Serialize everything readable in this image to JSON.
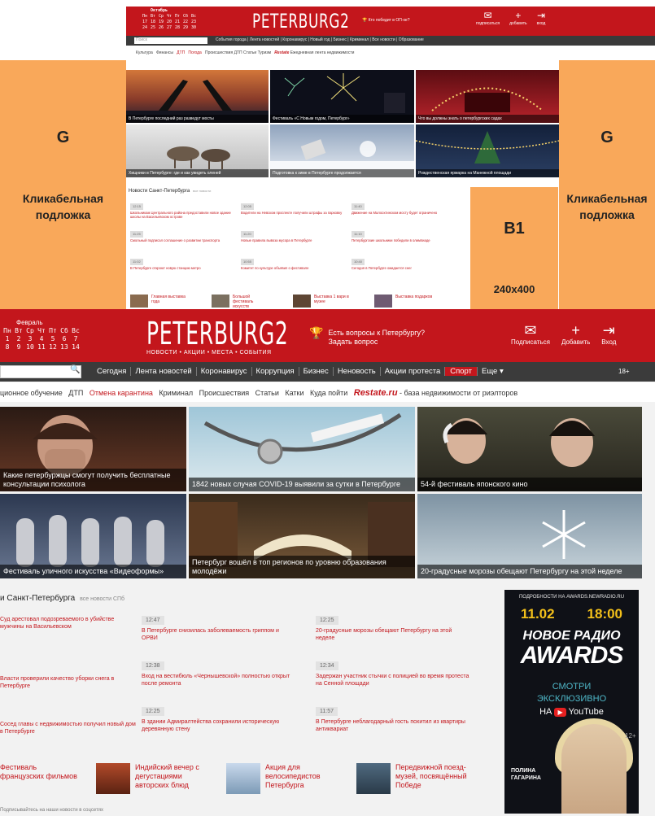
{
  "mock": {
    "calendar": {
      "month": "Октябрь",
      "weekdays": [
        "Пн",
        "Вт",
        "Ср",
        "Чт",
        "Пт",
        "Сб",
        "Вс"
      ],
      "rows": [
        [
          "17",
          "18",
          "19",
          "20",
          "21",
          "22",
          "23"
        ],
        [
          "24",
          "25",
          "26",
          "27",
          "28",
          "29",
          "30"
        ]
      ]
    },
    "logo": "PETERBURG2",
    "cup_text": "Кто победит в ОП-хе?",
    "actions": [
      {
        "icon": "✉",
        "label": "подписаться"
      },
      {
        "icon": "+",
        "label": "добавить"
      },
      {
        "icon": "⇥",
        "label": "вход"
      }
    ],
    "search_placeholder": "Поиск",
    "nav": "События города | Лента новостей | Коронавирус | Новый год | Бизнес | Криминал | Все новости | Образование",
    "sub_links": [
      "Культура",
      "Финансы"
    ],
    "sub_red": [
      "ДТП",
      "Погода"
    ],
    "sub_rest": "Происшествия   ДТП   Статьи   Туризм",
    "sub_brand": "Restate",
    "sub_brand_text": "Ежедневная лента недвижимости",
    "g_letter": "G",
    "g_text": "Кликабельная подложка",
    "tiles": [
      {
        "caption": "В Петербурге последний раз разведут мосты"
      },
      {
        "caption": "Фестиваль «С Новым годом, Петербург»"
      },
      {
        "caption": "Что вы должны знать о петербургских садах"
      },
      {
        "caption": "Хищники в Петербурге: где и как увидеть оленей"
      },
      {
        "caption": "Подготовка к зиме в Петербурге продолжается"
      },
      {
        "caption": "Рождественская ярмарка на Манежной площади"
      }
    ],
    "news_title": "Новости Санкт-Петербурга",
    "news_all": "все новости",
    "news": [
      {
        "time": "12:15",
        "text": "Школьникам Центрального района предоставили новое здание школы на Васильевском острове"
      },
      {
        "time": "12:05",
        "text": "Водители на Невском проспекте получили штрафы за парковку"
      },
      {
        "time": "11:40",
        "text": "Движение на Малоохтинском мосту будет ограничено"
      },
      {
        "time": "11:25",
        "text": "Смольный подписал соглашение о развитии транспорта"
      },
      {
        "time": "11:20",
        "text": "Новые правила вывоза мусора в Петербурге"
      },
      {
        "time": "11:10",
        "text": "Петербургские школьники победили в олимпиаде"
      },
      {
        "time": "11:02",
        "text": "В Петербурге откроют новую станцию метро"
      },
      {
        "time": "10:55",
        "text": "Комитет по культуре объявил о фестивале"
      },
      {
        "time": "10:40",
        "text": "Сегодня в Петербурге ожидается снег"
      }
    ],
    "b1_title": "B1",
    "b1_size": "240x400",
    "thumbs": [
      {
        "text": "Главная выставка года"
      },
      {
        "text": "Большой фестиваль искусств"
      },
      {
        "text": "Выставка 1 вари в музее"
      },
      {
        "text": "Выставка подарков"
      }
    ]
  },
  "big": {
    "calendar": {
      "month": "Февраль",
      "weekdays": [
        "Пн",
        "Вт",
        "Ср",
        "Чт",
        "Пт",
        "Сб",
        "Вс"
      ],
      "rows": [
        [
          "1",
          "2",
          "3",
          "4",
          "5",
          "6",
          "7"
        ],
        [
          "8",
          "9",
          "10",
          "11",
          "12",
          "13",
          "14"
        ]
      ]
    },
    "logo": "PETERBURG2",
    "tagline": "НОВОСТИ • АКЦИИ • МЕСТА • СОБЫТИЯ",
    "cup_text": "Есть вопросы к Петербургу? Задать вопрос",
    "actions": [
      {
        "icon": "✉",
        "label": "Подписаться"
      },
      {
        "icon": "+",
        "label": "Добавить"
      },
      {
        "icon": "⇥",
        "label": "Вход"
      }
    ],
    "search_icon": "🔍",
    "nav": [
      "Сегодня",
      "Лента новостей",
      "Коронавирус",
      "Коррупция",
      "Бизнес",
      "Неновость",
      "Акции протеста",
      "Спорт",
      "Еще ▾"
    ],
    "nav_active": "Спорт",
    "nav_more": "18+",
    "sub": {
      "plain1": "ционное обучение   ДТП   ",
      "red": "Отмена карантина",
      "plain2": "   Криминал   Происшествия   Статьи   Катки   Куда пойти   ",
      "brand": "Restate.ru",
      "brand_text": " - база недвижимости от риэлторов"
    },
    "tiles": [
      {
        "caption": "Какие петербуржцы смогут получить бесплатные консультации психолога"
      },
      {
        "caption": "1842 новых случая COVID-19 выявили за сутки в Петербурге"
      },
      {
        "caption": "54-й фестиваль японского кино"
      },
      {
        "caption": "Фестиваль уличного искусства «Видеоформы»"
      },
      {
        "caption": "Петербург вошёл в топ регионов по уровню образования молодёжи"
      },
      {
        "caption": "20-градусные морозы обещают Петербургу на этой неделе"
      }
    ],
    "news_title": "и Санкт-Петербурга",
    "news_all": "все новости СПб",
    "news": [
      {
        "time": "",
        "text": "Суд арестовал подозреваемого в убийстве мужчины на Васильевском"
      },
      {
        "time": "12:47",
        "text": "В Петербурге снизилась заболеваемость гриппом и ОРВИ"
      },
      {
        "time": "12:25",
        "text": "20-градусные морозы обещают Петербургу на этой неделе"
      },
      {
        "time": "",
        "text": "Власти проверили качество уборки снега в Петербурге"
      },
      {
        "time": "12:38",
        "text": "Вход на вестибюль «Чернышевской» полностью открыт после ремонта"
      },
      {
        "time": "12:34",
        "text": "Задержан участник стычки с полицией во время протеста на Сенной площади"
      },
      {
        "time": "",
        "text": "Сосед главы с недвижимостью получил новый дом в Петербурге"
      },
      {
        "time": "12:25",
        "text": "В здании Адмиралтейства сохранили историческую деревянную стену"
      },
      {
        "time": "11:57",
        "text": "В Петербурге неблагодарный гость похитил из квартиры антиквариат"
      }
    ],
    "thumbs": [
      {
        "text": "Фестиваль французских фильмов"
      },
      {
        "text": "Индийский вечер с дегустациями авторских блюд"
      },
      {
        "text": "Акция для велосипедистов Петербурга"
      },
      {
        "text": "Передвижной поезд-музей, посвящённый Победе"
      }
    ],
    "ad": {
      "top": "ПОДРОБНОСТИ НА AWARDS.NEWRADIO.RU",
      "date": "11.02",
      "time": "18:00",
      "logo1": "НОВОЕ РАДИО",
      "logo2": "AWARDS",
      "watch1": "СМОТРИ",
      "watch2": "ЭКСКЛЮЗИВНО",
      "on": "НА",
      "yt": "YouTube",
      "name": "ПОЛИНА ГАГАРИНА",
      "arrow": "12+"
    },
    "bottom": "Подписывайтесь на наши новости в соцсетях"
  }
}
